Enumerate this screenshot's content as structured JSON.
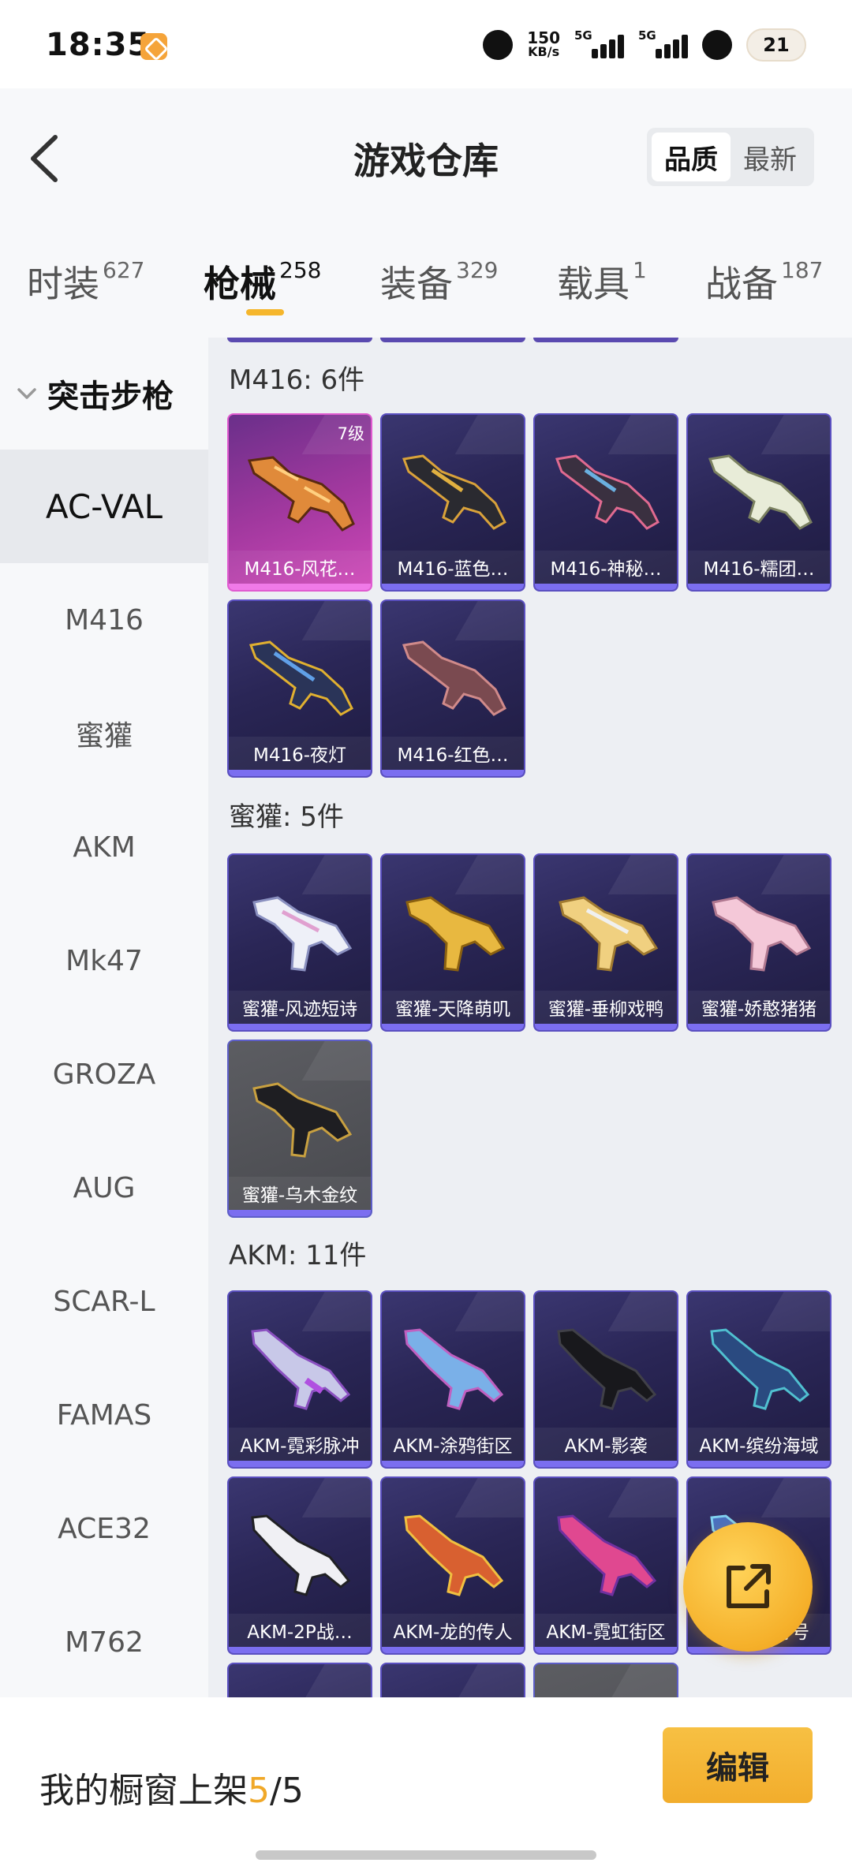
{
  "status_bar": {
    "time": "18:35",
    "net_speed_value": "150",
    "net_speed_unit": "KB/s",
    "signal1_label": "5G",
    "signal2_label": "5G",
    "battery": "21"
  },
  "header": {
    "title": "游戏仓库",
    "sort_options": [
      "品质",
      "最新"
    ],
    "sort_selected": "品质"
  },
  "tabs": [
    {
      "label": "时装",
      "count": "627"
    },
    {
      "label": "枪械",
      "count": "258"
    },
    {
      "label": "装备",
      "count": "329"
    },
    {
      "label": "载具",
      "count": "1"
    },
    {
      "label": "战备",
      "count": "187"
    }
  ],
  "active_tab": "枪械",
  "sidebar": {
    "category": "突击步枪",
    "items": [
      "AC-VAL",
      "M416",
      "蜜獾",
      "AKM",
      "Mk47",
      "GROZA",
      "AUG",
      "SCAR-L",
      "FAMAS",
      "ACE32",
      "M762"
    ],
    "active": "AC-VAL"
  },
  "sections": [
    {
      "title": "M416: 6件",
      "items": [
        {
          "name": "M416-风花…",
          "level": "7级",
          "rarity": "legend"
        },
        {
          "name": "M416-蓝色…",
          "rarity": "epic"
        },
        {
          "name": "M416-神秘…",
          "rarity": "epic"
        },
        {
          "name": "M416-糯团…",
          "rarity": "epic"
        },
        {
          "name": "M416-夜灯",
          "rarity": "epic"
        },
        {
          "name": "M416-红色…",
          "rarity": "epic"
        }
      ]
    },
    {
      "title": "蜜獾: 5件",
      "items": [
        {
          "name": "蜜獾-风迹短诗",
          "rarity": "epic"
        },
        {
          "name": "蜜獾-天降萌叽",
          "rarity": "epic"
        },
        {
          "name": "蜜獾-垂柳戏鸭",
          "rarity": "epic"
        },
        {
          "name": "蜜獾-娇憨猪猪",
          "rarity": "epic"
        },
        {
          "name": "蜜獾-乌木金纹",
          "rarity": "plain"
        }
      ]
    },
    {
      "title": "AKM: 11件",
      "items": [
        {
          "name": "AKM-霓彩脉冲",
          "rarity": "epic"
        },
        {
          "name": "AKM-涂鸦街区",
          "rarity": "epic"
        },
        {
          "name": "AKM-影袭",
          "rarity": "epic"
        },
        {
          "name": "AKM-缤纷海域",
          "rarity": "epic"
        },
        {
          "name": "AKM-2P战…",
          "rarity": "epic"
        },
        {
          "name": "AKM-龙的传人",
          "rarity": "epic"
        },
        {
          "name": "AKM-霓虹街区",
          "rarity": "epic"
        },
        {
          "name": "AKM-…符号",
          "rarity": "epic"
        }
      ]
    }
  ],
  "bottom": {
    "shelf_label": "我的橱窗上架",
    "shelf_used": "5",
    "shelf_sep": "/",
    "shelf_total": "5",
    "edit_label": "编辑"
  },
  "colors": {
    "accent": "#f5b62c",
    "epic_border": "#5a4fc0",
    "legend_border": "#e05ad0"
  }
}
